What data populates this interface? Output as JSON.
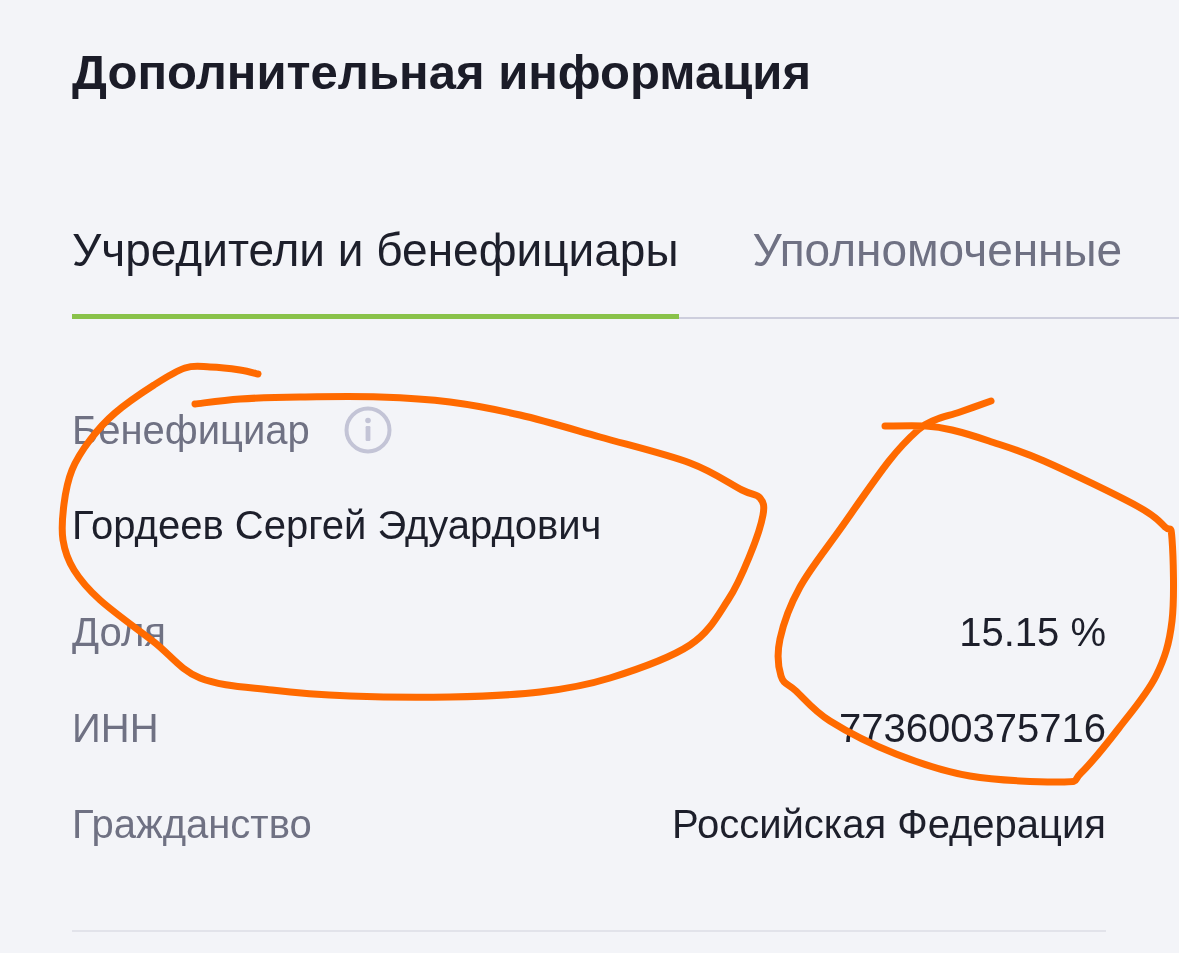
{
  "title": "Дополнительная информация",
  "tabs": [
    {
      "label": "Учредители и бенефициары",
      "selected": true
    },
    {
      "label": "Уполномоченные",
      "selected": false
    }
  ],
  "beneficiary": {
    "label": "Бенефициар",
    "name": "Гордеев Сергей Эдуардович"
  },
  "details": [
    {
      "label": "Доля",
      "value": "15.15 %"
    },
    {
      "label": "ИНН",
      "value": "773600375716"
    },
    {
      "label": "Гражданство",
      "value": "Российская Федерация"
    }
  ],
  "hand_drawn_marks": [
    {
      "kind": "freehand-loop"
    },
    {
      "kind": "freehand-loop"
    }
  ]
}
